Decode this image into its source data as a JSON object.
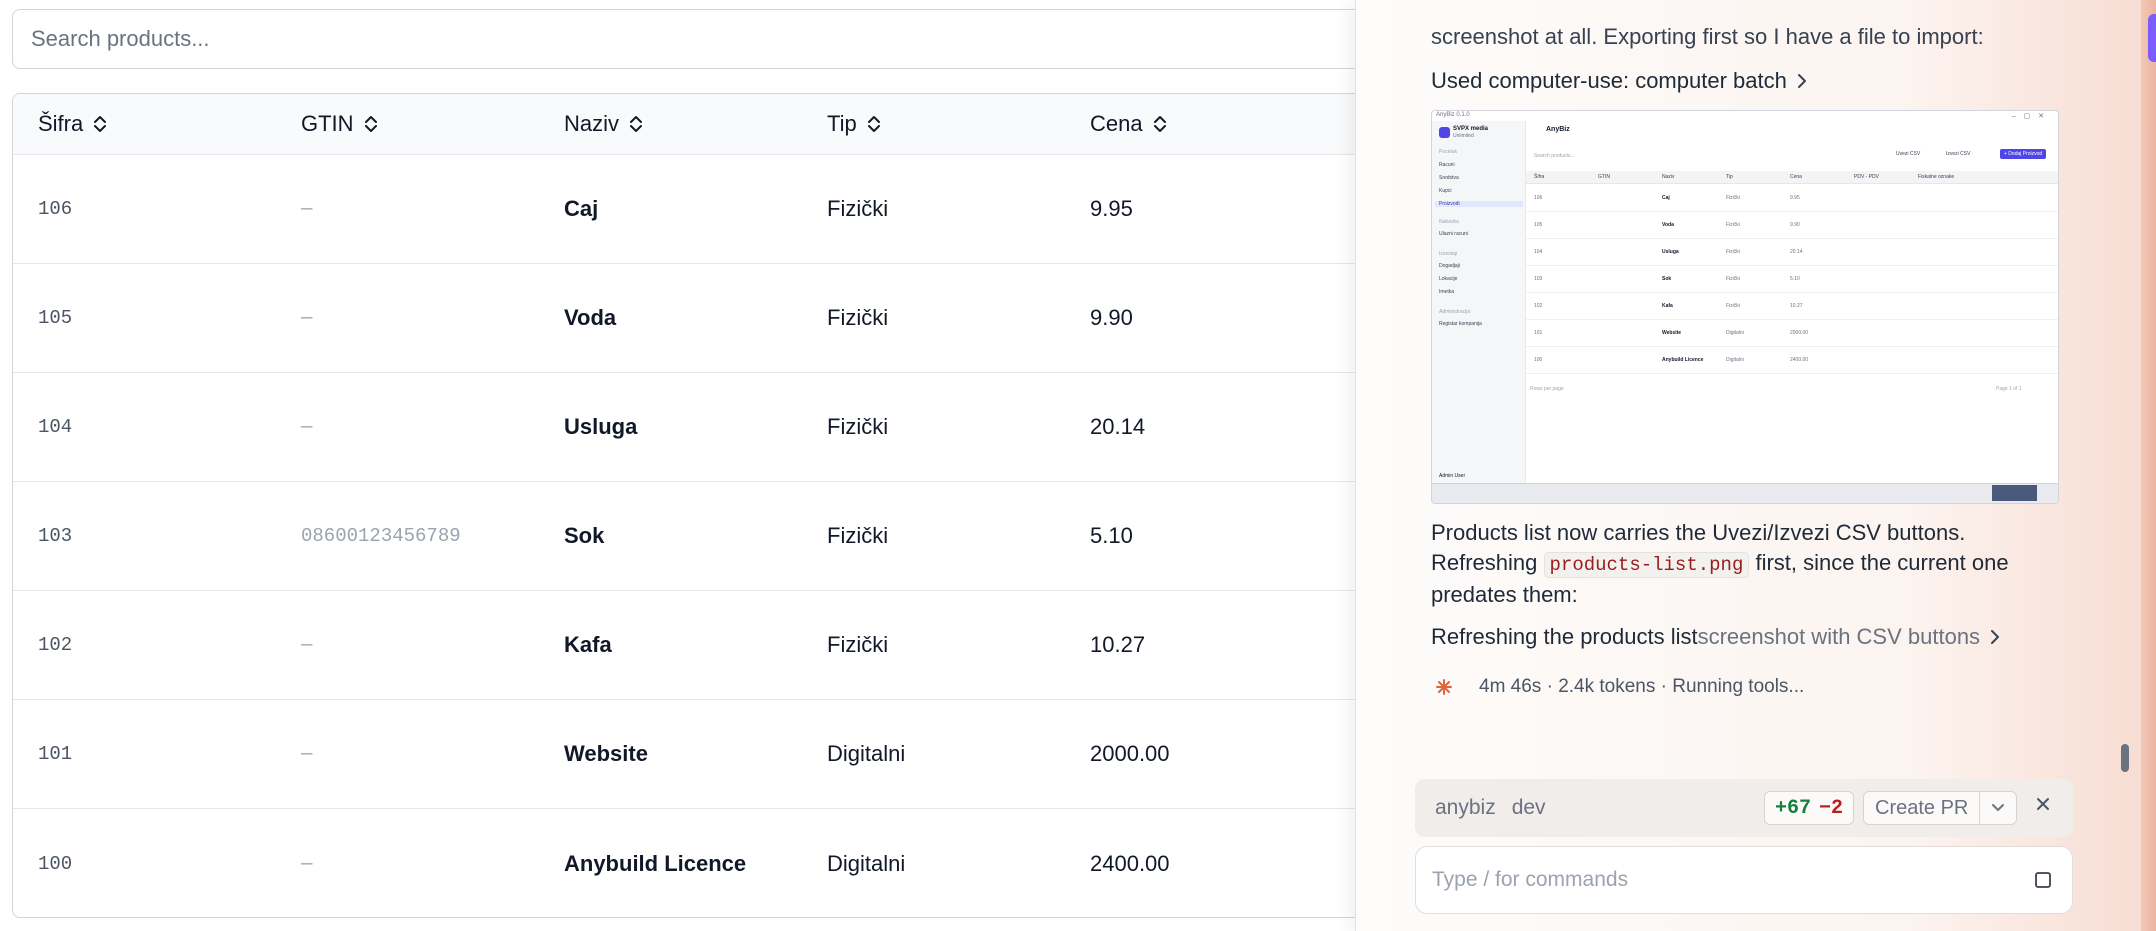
{
  "search": {
    "placeholder": "Search products..."
  },
  "table": {
    "columns": [
      "Šifra",
      "GTIN",
      "Naziv",
      "Tip",
      "Cena"
    ],
    "rows": [
      {
        "code": "106",
        "gtin": "—",
        "name": "Caj",
        "type": "Fizički",
        "price": "9.95"
      },
      {
        "code": "105",
        "gtin": "—",
        "name": "Voda",
        "type": "Fizički",
        "price": "9.90"
      },
      {
        "code": "104",
        "gtin": "—",
        "name": "Usluga",
        "type": "Fizički",
        "price": "20.14"
      },
      {
        "code": "103",
        "gtin": "08600123456789",
        "name": "Sok",
        "type": "Fizički",
        "price": "5.10"
      },
      {
        "code": "102",
        "gtin": "—",
        "name": "Kafa",
        "type": "Fizički",
        "price": "10.27"
      },
      {
        "code": "101",
        "gtin": "—",
        "name": "Website",
        "type": "Digitalni",
        "price": "2000.00"
      },
      {
        "code": "100",
        "gtin": "—",
        "name": "Anybuild Licence",
        "type": "Digitalni",
        "price": "2400.00"
      }
    ]
  },
  "chat": {
    "cut_text": "screenshot at all. Exporting first so I have a file to import:",
    "tool1": "Used computer-use: computer batch",
    "screenshot": {
      "window_title": "AnyBiz 0.1.0",
      "brand": "SVPX media",
      "brand_sub": "Unlimited",
      "page_title": "AnyBiz",
      "search_placeholder": "Search products...",
      "nav": [
        "Pocetak",
        "Racuni",
        "Sredstva",
        "Kupci",
        "Proizvodi",
        "Nabavka",
        "Ulazni racuni",
        "Izvestaji",
        "Dogadjaji",
        "Lokacije",
        "Imetka",
        "Administracija",
        "Registar kompanija"
      ],
      "user": "Admin User",
      "buttons": [
        "Uvezi CSV",
        "Izvezi CSV",
        "+ Dodaj Proizvod"
      ],
      "columns": [
        "Šifra",
        "GTIN",
        "Naziv",
        "Tip",
        "Cena",
        "PDV - PDV",
        "Fiskalne oznake"
      ],
      "rows_per_page": "Rows per page",
      "page_of": "Page 1 of 1"
    },
    "message": {
      "before": "Products list now carries the Uvezi/Izvezi CSV buttons. Refreshing ",
      "code": "products-list.png",
      "after": " first, since the current one predates them:"
    },
    "tool2_main": "Refreshing the products list",
    "tool2_muted": " screenshot with CSV buttons",
    "status": "4m 46s · 2.4k tokens · Running tools...",
    "pr": {
      "repo": "anybiz",
      "branch": "dev",
      "additions": "+67",
      "deletions": "−2",
      "create_label": "Create PR"
    },
    "input_placeholder": "Type / for commands"
  },
  "colors": {
    "accent": "#7c5cff",
    "diff_add": "#15803d",
    "diff_del": "#b91c1c",
    "spark": "#e0663a"
  }
}
